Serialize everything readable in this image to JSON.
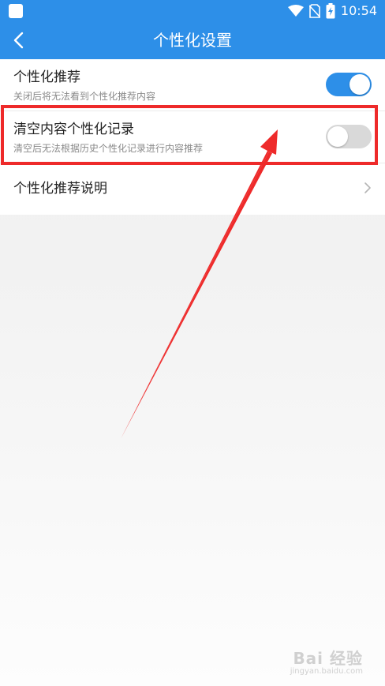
{
  "status_bar": {
    "time": "10:54",
    "icons": [
      "app-square-icon",
      "wifi-icon",
      "no-sim-icon",
      "battery-charging-icon"
    ]
  },
  "app_bar": {
    "title": "个性化设置",
    "back_icon": "back-arrow-icon"
  },
  "settings": [
    {
      "label": "个性化推荐",
      "description": "关闭后将无法看到个性化推荐内容",
      "toggle": "on"
    },
    {
      "label": "清空内容个性化记录",
      "description": "清空后无法根据历史个性化记录进行内容推荐",
      "toggle": "off"
    },
    {
      "label": "个性化推荐说明",
      "icon": "chevron-right-icon"
    }
  ],
  "annotation": {
    "highlight_color": "#ee2a2a",
    "arrow_color": "#ee2a2a"
  },
  "watermark": {
    "logo": "Bai 经验",
    "sub": "jingyan.baidu.com"
  },
  "colors": {
    "primary": "#2d8fe8",
    "toggle_off": "#d9d9d9"
  }
}
